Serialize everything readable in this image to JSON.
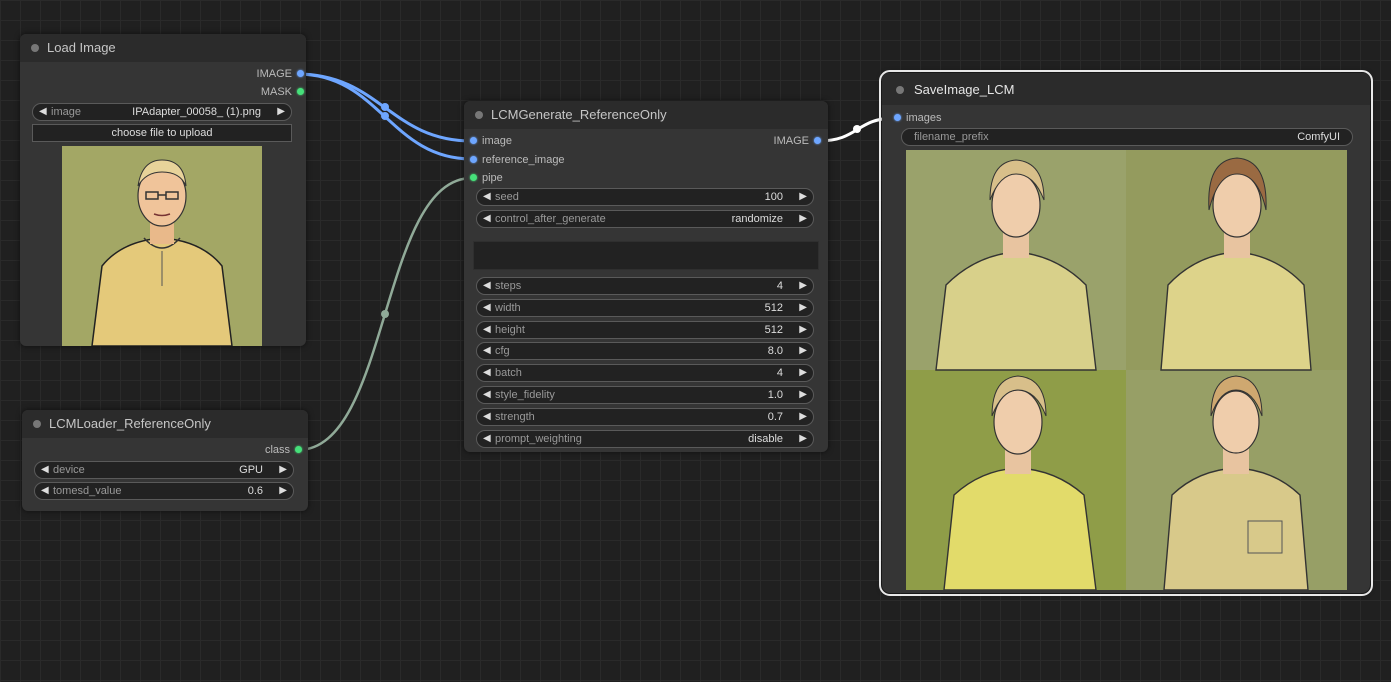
{
  "nodes": {
    "load_image": {
      "title": "Load Image",
      "outputs": [
        "IMAGE",
        "MASK"
      ],
      "image_widget": {
        "label": "image",
        "value": "IPAdapter_00058_ (1).png"
      },
      "upload_button": "choose file to upload"
    },
    "lcm_loader": {
      "title": "LCMLoader_ReferenceOnly",
      "output": "class",
      "widgets": [
        {
          "label": "device",
          "value": "GPU"
        },
        {
          "label": "tomesd_value",
          "value": "0.6"
        }
      ]
    },
    "lcm_generate": {
      "title": "LCMGenerate_ReferenceOnly",
      "inputs": [
        "image",
        "reference_image",
        "pipe"
      ],
      "output": "IMAGE",
      "widgets_top": [
        {
          "label": "seed",
          "value": "100"
        },
        {
          "label": "control_after_generate",
          "value": "randomize"
        }
      ],
      "widgets": [
        {
          "label": "steps",
          "value": "4"
        },
        {
          "label": "width",
          "value": "512"
        },
        {
          "label": "height",
          "value": "512"
        },
        {
          "label": "cfg",
          "value": "8.0"
        },
        {
          "label": "batch",
          "value": "4"
        },
        {
          "label": "style_fidelity",
          "value": "1.0"
        },
        {
          "label": "strength",
          "value": "0.7"
        },
        {
          "label": "prompt_weighting",
          "value": "disable"
        }
      ]
    },
    "save_image": {
      "title": "SaveImage_LCM",
      "input": "images",
      "filename_widget": {
        "label": "filename_prefix",
        "value": "ComfyUI"
      }
    }
  },
  "colors": {
    "image_link": "#6ea6ff",
    "pipe_link": "#90aa98",
    "selected_link": "#ffffff"
  }
}
